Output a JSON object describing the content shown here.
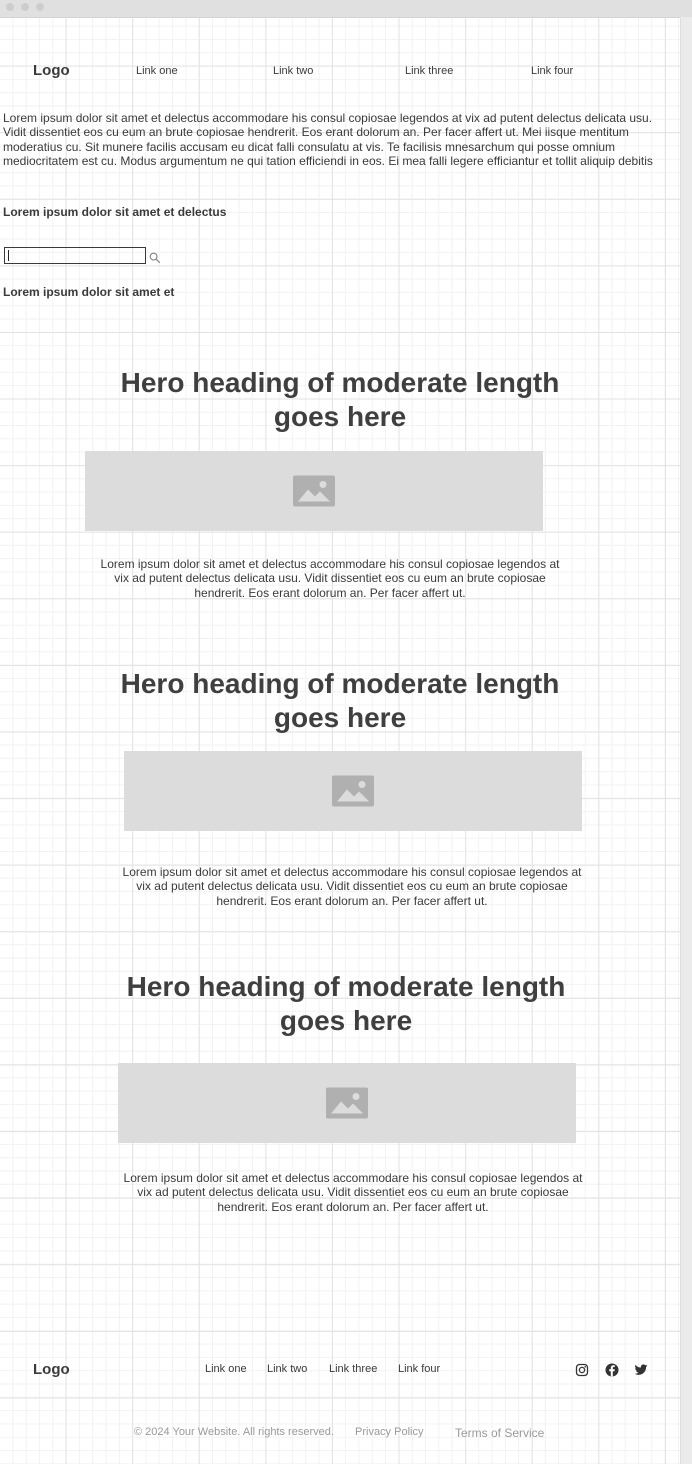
{
  "header": {
    "logo": "Logo",
    "nav": [
      "Link one",
      "Link two",
      "Link three",
      "Link four"
    ]
  },
  "intro": {
    "paragraph": "Lorem ipsum dolor sit amet et delectus accommodare his consul copiosae legendos at vix ad putent delectus delicata usu. Vidit dissentiet eos cu eum an brute copiosae hendrerit. Eos erant dolorum an. Per facer affert ut. Mei iisque mentitum moderatius cu. Sit munere facilis accusam eu dicat falli consulatu at vis. Te facilisis mnesarchum qui posse omnium mediocritatem est cu. Modus argumentum ne qui tation efficiendi in eos. Ei mea falli legere efficiantur et tollit aliquip debitis",
    "label_1": "Lorem ipsum dolor sit amet et delectus",
    "search": {
      "value": "",
      "placeholder": ""
    },
    "label_2": "Lorem ipsum dolor sit amet et"
  },
  "sections": [
    {
      "heading_line1": "Hero heading of moderate length",
      "heading_line2": "goes here",
      "text": "Lorem ipsum dolor sit amet et delectus accommodare his consul copiosae legendos at vix ad putent delectus delicata usu. Vidit dissentiet eos cu eum an brute copiosae hendrerit. Eos erant dolorum an. Per facer affert ut."
    },
    {
      "heading_line1": "Hero heading of moderate length",
      "heading_line2": "goes here",
      "text": "Lorem ipsum dolor sit amet et delectus accommodare his consul copiosae legendos at vix ad putent delectus delicata usu. Vidit dissentiet eos cu eum an brute copiosae hendrerit. Eos erant dolorum an. Per facer affert ut."
    },
    {
      "heading_line1": "Hero heading of moderate length",
      "heading_line2": "goes here",
      "text": "Lorem ipsum dolor sit amet et delectus accommodare his consul copiosae legendos at vix ad putent delectus delicata usu. Vidit dissentiet eos cu eum an brute copiosae hendrerit. Eos erant dolorum an. Per facer affert ut."
    }
  ],
  "footer": {
    "logo": "Logo",
    "links": [
      "Link one",
      "Link two",
      "Link three",
      "Link four"
    ],
    "social_icons": [
      "instagram-icon",
      "facebook-icon",
      "twitter-icon"
    ],
    "copyright": "© 2024 Your Website. All rights reserved.",
    "privacy": "Privacy Policy",
    "terms": "Terms of Service"
  },
  "colors": {
    "text": "#3f3f3f",
    "placeholder_bg": "#dcdcdc",
    "placeholder_icon": "#b0b0b0",
    "muted": "#9a9a9a"
  }
}
